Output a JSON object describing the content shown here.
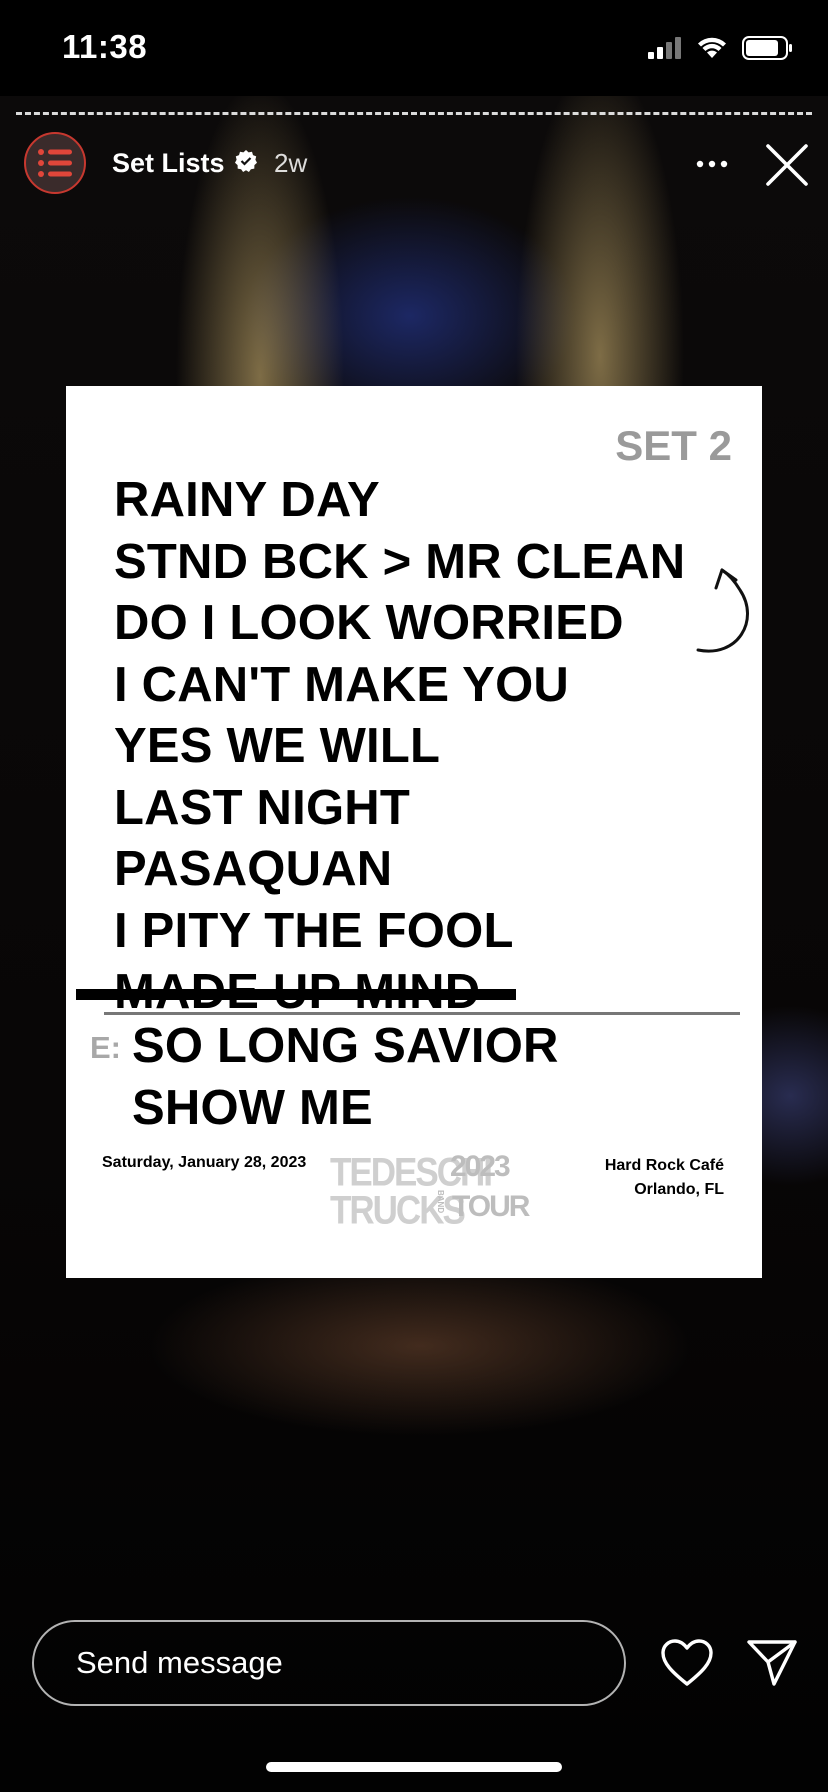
{
  "status_bar": {
    "time": "11:38",
    "icons": [
      "signal-icon",
      "wifi-icon",
      "battery-icon"
    ]
  },
  "story": {
    "account_name": "Set Lists",
    "time_ago": "2w",
    "verified": true,
    "avatar_icon": "list-icon",
    "accent_color": "#c7382f"
  },
  "setlist": {
    "set_label": "SET 2",
    "songs": [
      "RAINY DAY",
      "STND BCK > MR CLEAN",
      "DO I LOOK WORRIED",
      "I CAN'T MAKE YOU",
      "YES WE WILL",
      "LAST NIGHT",
      "PASAQUAN",
      "I PITY THE FOOL",
      "MADE UP MIND"
    ],
    "struck_song": "MADE UP MIND",
    "encore_label": "E:",
    "encore_songs": [
      "SO LONG SAVIOR",
      "SHOW ME"
    ],
    "date": "Saturday, January 28, 2023",
    "logo_line1": "TEDESCHI",
    "logo_line2": "TRUCKS",
    "logo_band": "BAND",
    "logo_year": "2023",
    "logo_tour": "TOUR",
    "venue_line1": "Hard Rock Café",
    "venue_line2": "Orlando, FL"
  },
  "bottom_bar": {
    "message_placeholder": "Send message",
    "like_icon": "heart-icon",
    "share_icon": "send-icon"
  }
}
